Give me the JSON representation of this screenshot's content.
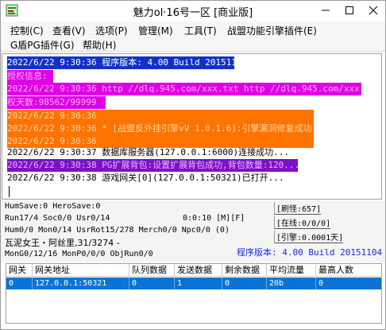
{
  "window": {
    "title": "魅力ol·16号一区 [商业版]"
  },
  "menu": {
    "control": "控制(C)",
    "view": "查看(V)",
    "options": "选项(P)",
    "manage": "管理(M)",
    "tools": "工具(T)",
    "plugins": "战盟功能引擎插件(E)",
    "g_plugin": "G盾PG插件(G)",
    "help": "帮助(H)"
  },
  "log": {
    "lines": [
      "2022/6/22 9:30:36 程序版本: 4.00 Build 20151104",
      "授权信息:",
      "2022/6/22 9:30:36 http //dlq.945.com/xxx.txt http //dlq.945.com/xxx.txt 授",
      "权天数:98562/99999",
      "2022/6/22 9:30:36",
      "2022/6/22 9:30:36 * [战盟反外挂引擎vV 1.0.1.6]:引擎漏洞修复成功...",
      "2022/6/22 9:30:36",
      "2022/6/22 9:30:37 数据库服务器(127.0.0.1:6000)连接成功...",
      "2022/6/22 9:30:38 PG扩展背包:设置扩展背包成功,背包数量:120...",
      "2022/6/22 9:30:38 游戏网关[0](127.0.0.1:50321)已打开..."
    ]
  },
  "status": {
    "humsave": "HumSave:0 HeroSave:0",
    "run": "Run17/4 Soc0/0 Usr0/14",
    "time": "0:0:10 [M][F]",
    "hum": "Hum0/0 Mon0/14 UsrRot15/278 Merch0/0 Npc0/0 (0)",
    "boss": "瓦泥女王・阿丝里,31/3274 -",
    "mon": "MonG0/12/16 MonP0/0/0 ObjRun0/0",
    "refresh": "[刷怪:657]",
    "online": "[在线:0/0/0]",
    "engine": "[引擎:0.0001天]",
    "version": "程序版本: 4.00 Build 20151104"
  },
  "table": {
    "headers": [
      "网关",
      "网关地址",
      "队列数据",
      "发送数据",
      "剩余数据",
      "平均流量",
      "最高人数"
    ],
    "rows": [
      [
        "0",
        "127.0.0.1:50321",
        "0",
        "1",
        "0",
        "20b",
        "0"
      ]
    ]
  },
  "colors": {
    "title_accent": "#1230c8",
    "magenta": "#e000e6",
    "orange": "#ff7300",
    "purple": "#7e10c8",
    "selected_row": "#0a74d6",
    "status_blue": "#1a2ed8"
  }
}
